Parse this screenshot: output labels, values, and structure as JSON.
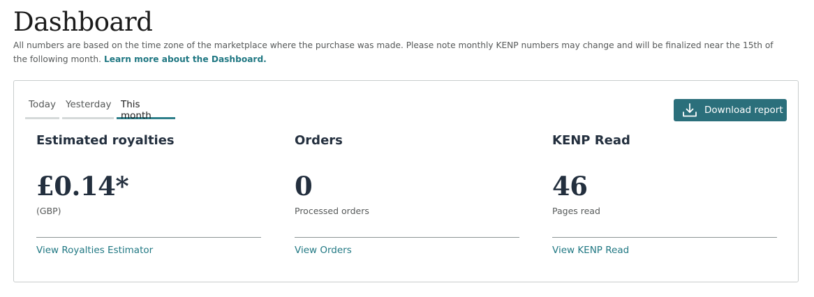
{
  "page": {
    "title": "Dashboard",
    "intro_text": "All numbers are based on the time zone of the marketplace where the purchase was made. Please note monthly KENP numbers may change and will be finalized near the 15th of the following month.",
    "intro_link": "Learn more about the Dashboard."
  },
  "tabs": [
    {
      "label": "Today",
      "active": false
    },
    {
      "label": "Yesterday",
      "active": false
    },
    {
      "label": "This month",
      "active": true
    }
  ],
  "download_button": {
    "label": "Download report",
    "icon": "download-icon"
  },
  "metrics": [
    {
      "title": "Estimated royalties",
      "value": "£0.14*",
      "subtitle": "(GBP)",
      "link": "View Royalties Estimator"
    },
    {
      "title": "Orders",
      "value": "0",
      "subtitle": "Processed orders",
      "link": "View Orders"
    },
    {
      "title": "KENP Read",
      "value": "46",
      "subtitle": "Pages read",
      "link": "View KENP Read"
    }
  ],
  "colors": {
    "accent": "#2b6f7b",
    "link": "#1f7782",
    "active_tab_underline": "#2e7f8a",
    "heading": "#232f3e",
    "muted_text": "#565959"
  }
}
